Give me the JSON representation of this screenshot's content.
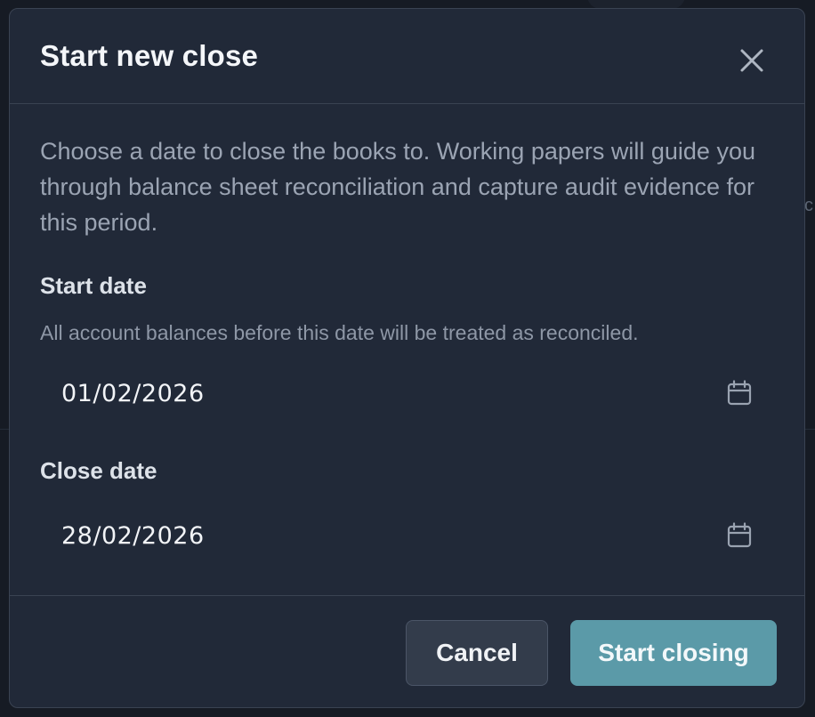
{
  "modal": {
    "title": "Start new close",
    "description": "Choose a date to close the books to. Working papers will guide you through balance sheet reconciliation and capture audit evidence for this period."
  },
  "fields": {
    "start_date": {
      "label": "Start date",
      "help": "All account balances before this date will be treated as reconciled.",
      "value": "01/02/2026",
      "icon": "calendar-icon"
    },
    "close_date": {
      "label": "Close date",
      "value": "28/02/2026",
      "icon": "calendar-icon"
    }
  },
  "footer": {
    "cancel_label": "Cancel",
    "submit_label": "Start closing"
  },
  "colors": {
    "modal_bg": "#212938",
    "primary": "#5b9aa8",
    "secondary_button": "#333c4b"
  }
}
